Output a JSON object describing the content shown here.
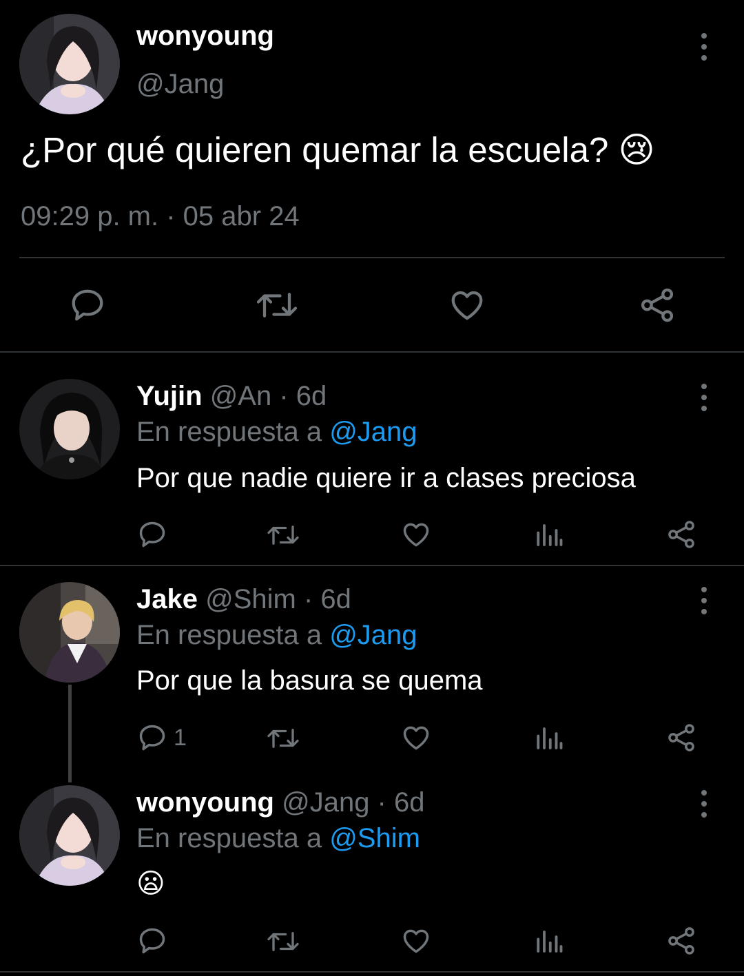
{
  "main_tweet": {
    "name": "wonyoung",
    "handle": "@Jang",
    "text": "¿Por qué quieren quemar la escuela?",
    "emoji": "😢",
    "timestamp": "09:29 p. m. · 05 abr 24"
  },
  "replies": [
    {
      "name": "Yujin",
      "meta": "@An · 6d",
      "reply_prefix": "En respuesta a",
      "reply_mention": "@Jang",
      "text": "Por que nadie quiere ir a clases preciosa",
      "reply_count": ""
    },
    {
      "name": "Jake",
      "meta": "@Shim · 6d",
      "reply_prefix": "En respuesta a",
      "reply_mention": "@Jang",
      "text": "Por que la basura se quema",
      "reply_count": "1"
    },
    {
      "name": "wonyoung",
      "meta": "@Jang · 6d",
      "reply_prefix": "En respuesta a",
      "reply_mention": "@Shim",
      "text": "😦",
      "reply_count": ""
    }
  ],
  "colors": {
    "background": "#000000",
    "text": "#e7e9ea",
    "secondary": "#71767b",
    "link": "#1d9bf0",
    "divider": "#2f3336"
  },
  "icons": [
    "reply-icon",
    "retweet-icon",
    "like-icon",
    "views-icon",
    "share-icon",
    "more-icon"
  ]
}
